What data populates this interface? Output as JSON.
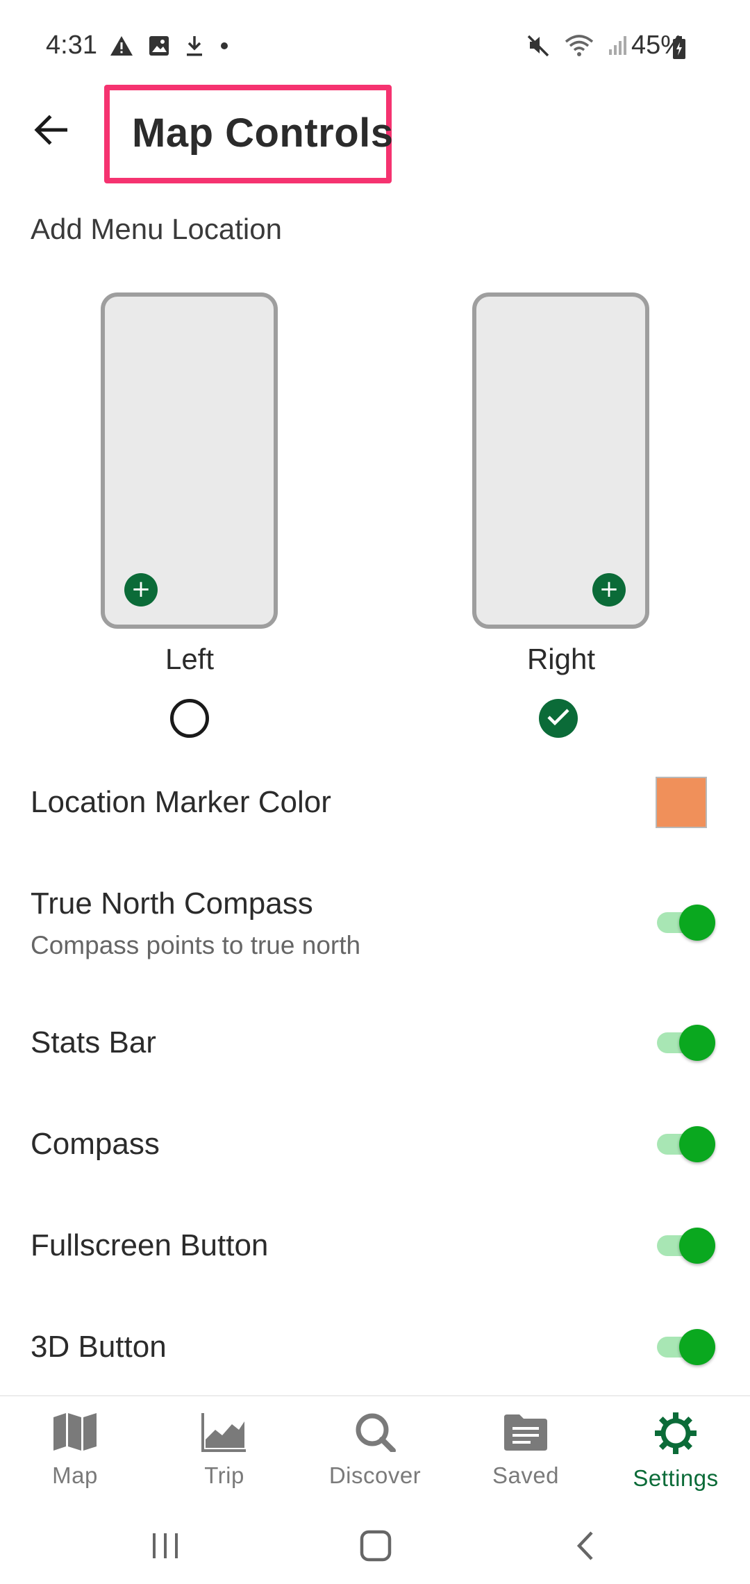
{
  "status_bar": {
    "time": "4:31",
    "battery_text": "45%",
    "left_icons": [
      "alert-icon",
      "image-icon",
      "download-icon",
      "dot-icon"
    ],
    "right_icons": [
      "mute-icon",
      "wifi-icon",
      "signal-icon",
      "battery-icon"
    ]
  },
  "header": {
    "title": "Map Controls",
    "back_icon": "arrow-left-icon",
    "highlight_color": "#f53370"
  },
  "menu_location": {
    "label": "Add Menu Location",
    "options": [
      {
        "label": "Left",
        "selected": false
      },
      {
        "label": "Right",
        "selected": true
      }
    ]
  },
  "settings": {
    "marker_color": {
      "label": "Location Marker Color",
      "color": "#f0905a"
    },
    "items": [
      {
        "label": "True North Compass",
        "sublabel": "Compass points to true north",
        "enabled": true
      },
      {
        "label": "Stats Bar",
        "enabled": true
      },
      {
        "label": "Compass",
        "enabled": true
      },
      {
        "label": "Fullscreen Button",
        "enabled": true
      },
      {
        "label": "3D Button",
        "enabled": true
      }
    ]
  },
  "bottom_nav": {
    "items": [
      {
        "label": "Map",
        "icon": "map-icon",
        "active": false
      },
      {
        "label": "Trip",
        "icon": "chart-icon",
        "active": false
      },
      {
        "label": "Discover",
        "icon": "search-icon",
        "active": false
      },
      {
        "label": "Saved",
        "icon": "folder-icon",
        "active": false
      },
      {
        "label": "Settings",
        "icon": "gear-icon",
        "active": true
      }
    ]
  },
  "colors": {
    "accent_green": "#0b6b38",
    "toggle_on": "#0aa81f",
    "toggle_track": "#a8e6b4",
    "inactive_nav": "#7a7a7a"
  }
}
